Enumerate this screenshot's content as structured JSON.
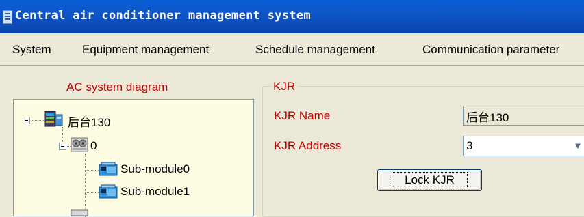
{
  "window": {
    "title": "Central air conditioner management system"
  },
  "menu": {
    "items": [
      "System",
      "Equipment management",
      "Schedule management",
      "Communication parameter"
    ]
  },
  "diagram": {
    "title": "AC system diagram",
    "tree": {
      "root": "后台130",
      "child": "0",
      "leaves": [
        "Sub-module0",
        "Sub-module1"
      ]
    }
  },
  "kjr": {
    "group_title": "KJR",
    "name_label": "KJR Name",
    "name_value": "后台130",
    "address_label": "KJR Address",
    "address_value": "3",
    "lock_button": "Lock KJR"
  },
  "colors": {
    "label_red": "#C00000",
    "title_blue": "#0A5FD6",
    "panel": "#ECE9D8"
  }
}
